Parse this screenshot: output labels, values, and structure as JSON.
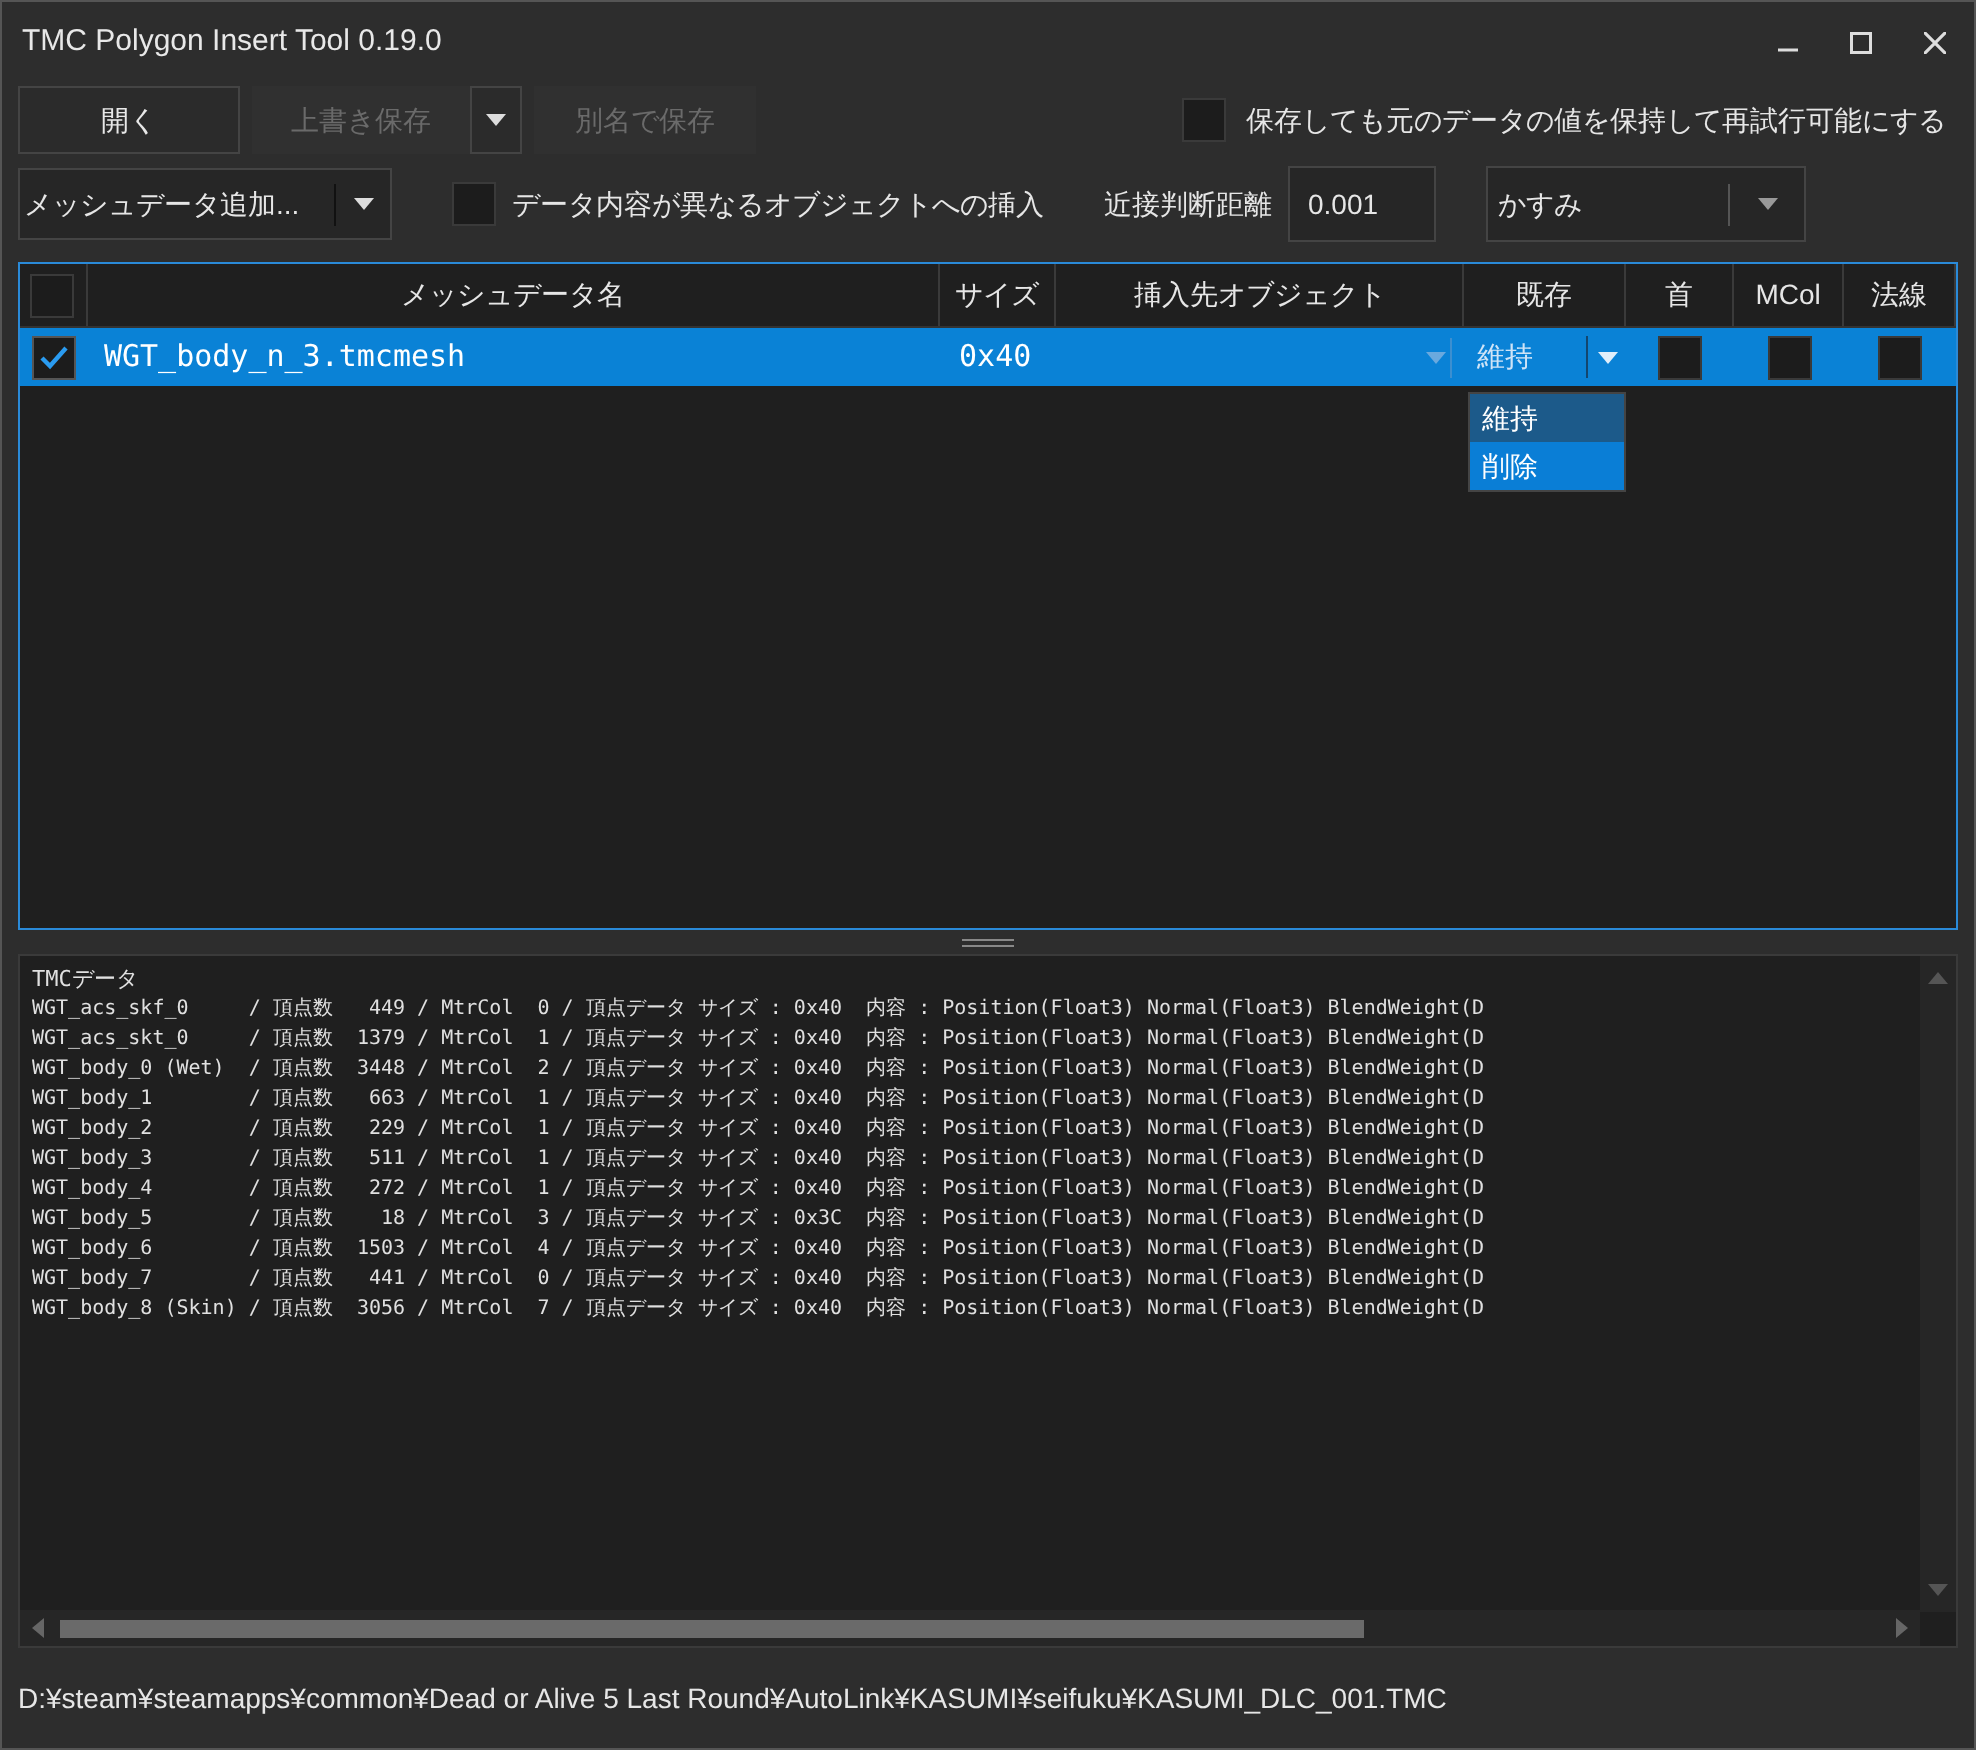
{
  "window": {
    "title": "TMC Polygon Insert Tool 0.19.0"
  },
  "toolbar": {
    "open_button": {
      "label": "開く",
      "disabled": false
    },
    "overwrite_save": {
      "label": "上書き保存",
      "disabled": true
    },
    "save_as": {
      "label": "別名で保存",
      "disabled": true
    },
    "keep_original": {
      "label": "保存しても元のデータの値を保持して再試行可能にする",
      "checked": false
    }
  },
  "options": {
    "mesh_add": {
      "label": "メッシュデータ追加..."
    },
    "different_object": {
      "label": "データ内容が異なるオブジェクトへの挿入",
      "checked": false
    },
    "distance_label": "近接判断距離",
    "distance_value": "0.001",
    "character": {
      "value": "かすみ"
    }
  },
  "table": {
    "header_checked": false,
    "columns": [
      "メッシュデータ名",
      "サイズ",
      "挿入先オブジェクト",
      "既存",
      "首",
      "MCol",
      "法線"
    ],
    "rows": [
      {
        "checked": true,
        "selected": true,
        "name": "WGT_body_n_3.tmcmesh",
        "size": "0x40",
        "existing": "維持",
        "neck": false,
        "mcol": false,
        "normal": false
      }
    ]
  },
  "dropdown_menu": {
    "items": [
      {
        "label": "維持",
        "selected": true
      },
      {
        "label": "削除",
        "selected": false
      }
    ]
  },
  "log": {
    "title": "TMCデータ",
    "lines": [
      "WGT_acs_skf_0     / 頂点数   449 / MtrCol  0 / 頂点データ サイズ : 0x40  内容 : Position(Float3) Normal(Float3) BlendWeight(D",
      "WGT_acs_skt_0     / 頂点数  1379 / MtrCol  1 / 頂点データ サイズ : 0x40  内容 : Position(Float3) Normal(Float3) BlendWeight(D",
      "WGT_body_0 (Wet)  / 頂点数  3448 / MtrCol  2 / 頂点データ サイズ : 0x40  内容 : Position(Float3) Normal(Float3) BlendWeight(D",
      "WGT_body_1        / 頂点数   663 / MtrCol  1 / 頂点データ サイズ : 0x40  内容 : Position(Float3) Normal(Float3) BlendWeight(D",
      "WGT_body_2        / 頂点数   229 / MtrCol  1 / 頂点データ サイズ : 0x40  内容 : Position(Float3) Normal(Float3) BlendWeight(D",
      "WGT_body_3        / 頂点数   511 / MtrCol  1 / 頂点データ サイズ : 0x40  内容 : Position(Float3) Normal(Float3) BlendWeight(D",
      "WGT_body_4        / 頂点数   272 / MtrCol  1 / 頂点データ サイズ : 0x40  内容 : Position(Float3) Normal(Float3) BlendWeight(D",
      "WGT_body_5        / 頂点数    18 / MtrCol  3 / 頂点データ サイズ : 0x3C  内容 : Position(Float3) Normal(Float3) BlendWeight(D",
      "WGT_body_6        / 頂点数  1503 / MtrCol  4 / 頂点データ サイズ : 0x40  内容 : Position(Float3) Normal(Float3) BlendWeight(D",
      "WGT_body_7        / 頂点数   441 / MtrCol  0 / 頂点データ サイズ : 0x40  内容 : Position(Float3) Normal(Float3) BlendWeight(D",
      "WGT_body_8 (Skin) / 頂点数  3056 / MtrCol  7 / 頂点データ サイズ : 0x40  内容 : Position(Float3) Normal(Float3) BlendWeight(D"
    ]
  },
  "status_bar": {
    "path": "D:¥steam¥steamapps¥common¥Dead or Alive 5 Last Round¥AutoLink¥KASUMI¥seifuku¥KASUMI_DLC_001.TMC"
  }
}
